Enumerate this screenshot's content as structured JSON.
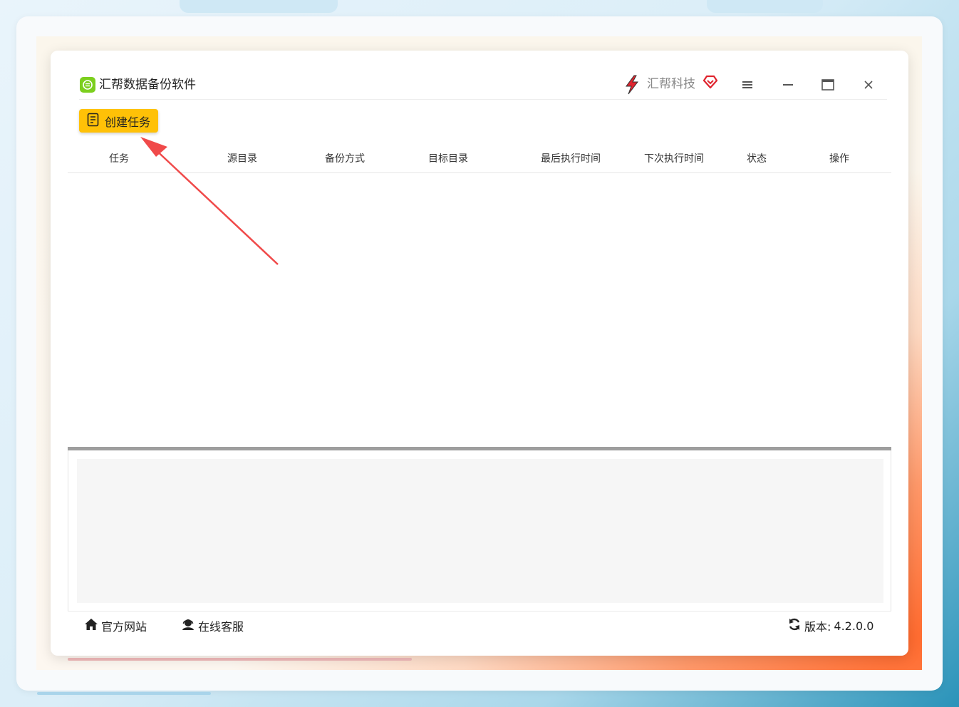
{
  "app": {
    "title": "汇帮数据备份软件"
  },
  "brand": {
    "name": "汇帮科技"
  },
  "toolbar": {
    "create_task_label": "创建任务"
  },
  "table": {
    "columns": [
      "任务",
      "源目录",
      "备份方式",
      "目标目录",
      "最后执行时间",
      "下次执行时间",
      "状态",
      "操作"
    ],
    "rows": []
  },
  "footer": {
    "website_label": "官方网站",
    "support_label": "在线客服",
    "version_label": "版本:",
    "version_value": "4.2.0.0"
  },
  "colors": {
    "accent": "#ffc107",
    "app_icon": "#7ccf1e",
    "annotation_arrow": "#f04a4a",
    "brand_red": "#e0242e"
  },
  "icons": {
    "app": "green-chat-icon",
    "brand": "lightning-logo-icon",
    "vip": "heart-diamond-icon",
    "menu": "hamburger-icon",
    "minimize": "minus-icon",
    "maximize": "window-icon",
    "close": "close-icon",
    "create": "document-edit-icon",
    "website": "home-icon",
    "support": "headset-user-icon",
    "refresh": "refresh-icon"
  }
}
